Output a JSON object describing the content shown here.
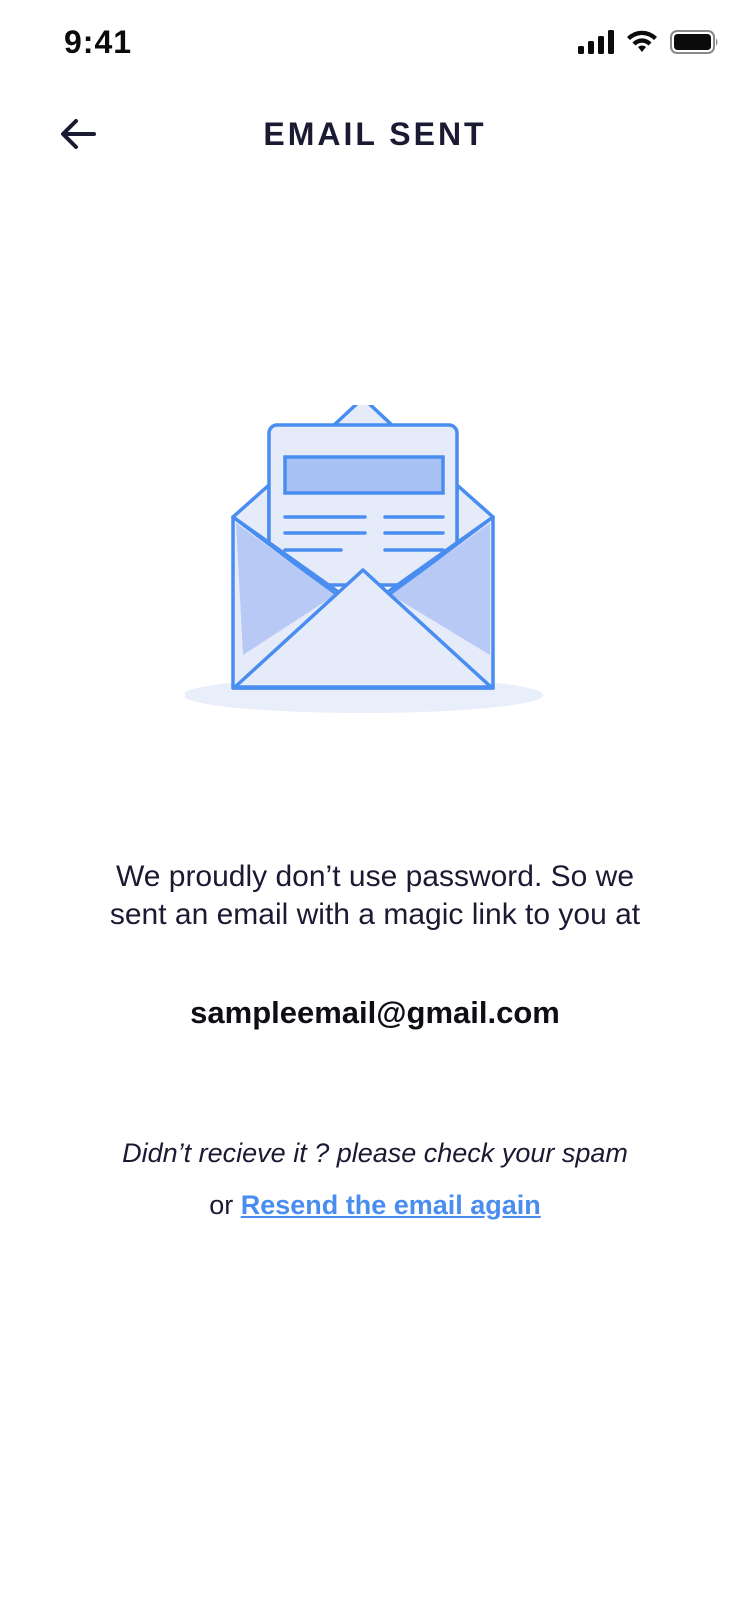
{
  "status_bar": {
    "time": "9:41",
    "icons": [
      "signal-icon",
      "wifi-icon",
      "battery-icon"
    ]
  },
  "header": {
    "title": "EMAIL SENT",
    "back_icon": "arrow-left-icon"
  },
  "illustration": {
    "icon": "open-envelope-icon",
    "colors": {
      "stroke": "#4a8df0",
      "fill_light": "#e6ebfa",
      "fill_mid": "#b9c9f5",
      "fill_bar": "#a9c2f6",
      "shadow": "#e9eefb"
    }
  },
  "message": {
    "body": "We proudly don’t use password. So we sent an email with a magic link to you at",
    "email": "sampleemail@gmail.com"
  },
  "footer": {
    "spam_note": "Didn’t recieve it ? please check your spam",
    "or_text": "or",
    "resend_label": "Resend the email again"
  },
  "colors": {
    "text": "#1b1a33",
    "link": "#4a8df0",
    "background": "#ffffff"
  }
}
